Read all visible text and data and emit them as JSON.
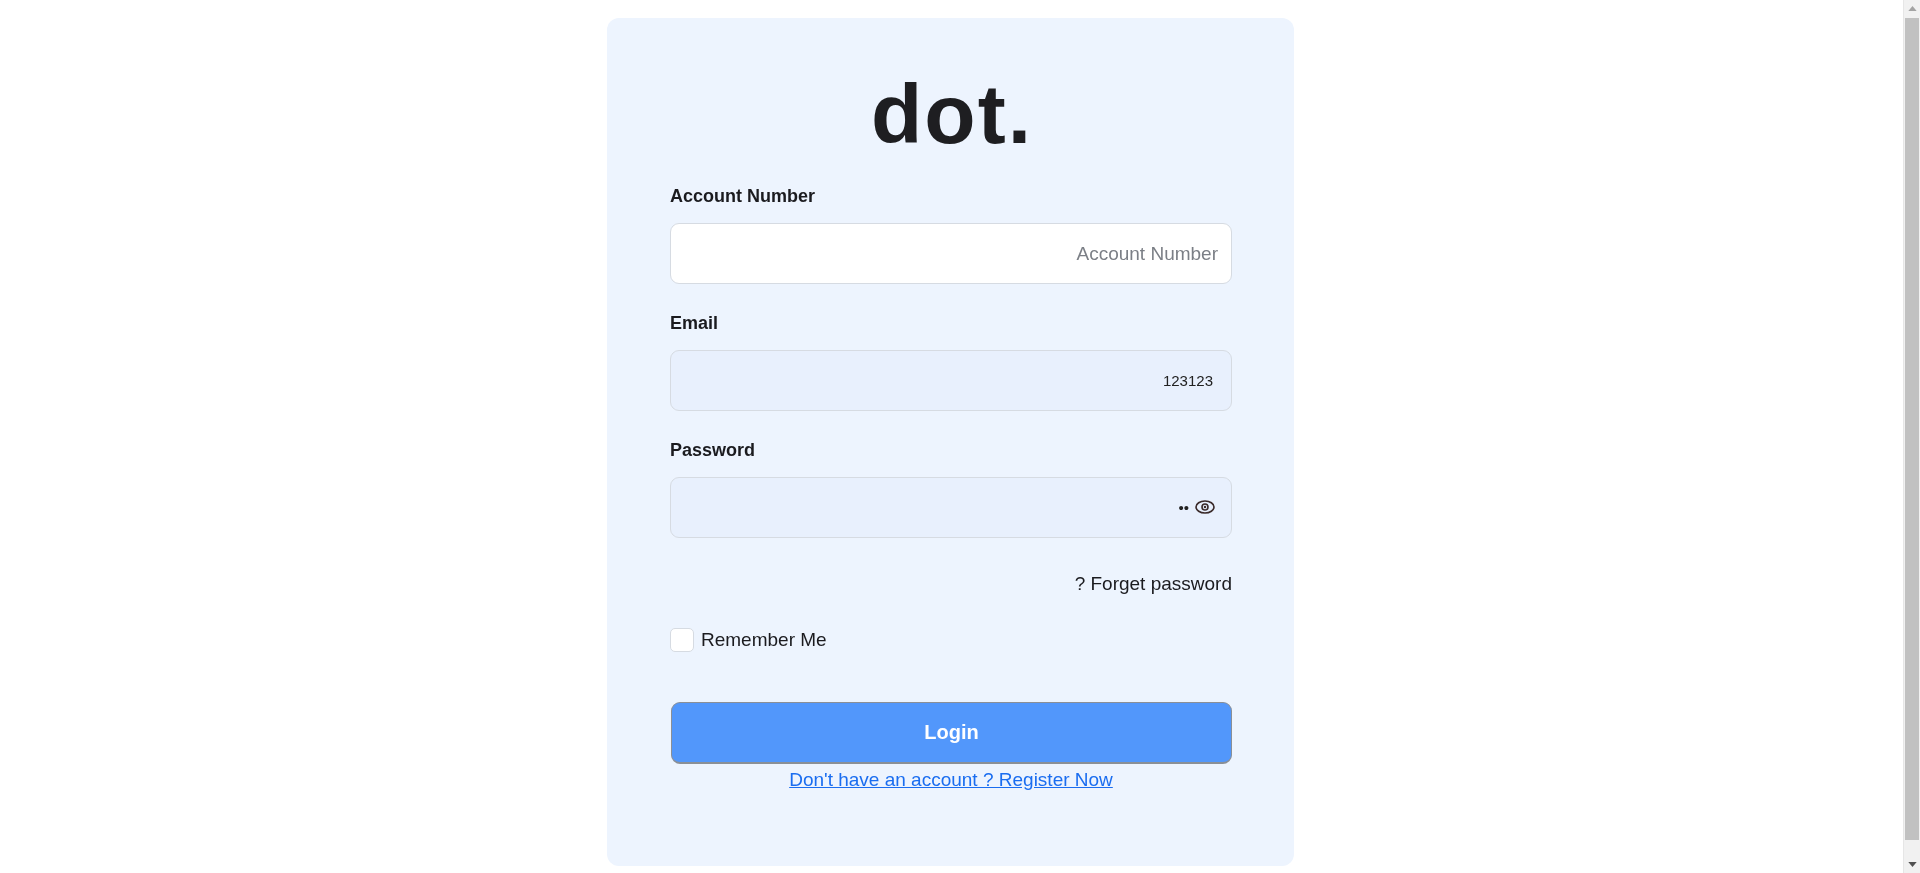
{
  "logo": {
    "text": "dot."
  },
  "fields": [
    {
      "kind": "text",
      "label": "Account Number",
      "placeholder": "Account Number",
      "autofilled": false
    },
    {
      "kind": "text",
      "label": "Email",
      "value": "123123",
      "autofilled": true
    },
    {
      "kind": "password",
      "label": "Password",
      "value": "••",
      "autofilled": true
    }
  ],
  "forgot_link": "? Forget password",
  "remember": {
    "label": "Remember Me",
    "checked": false
  },
  "login_button": "Login",
  "register_link": "Don't have an account ? Register Now"
}
